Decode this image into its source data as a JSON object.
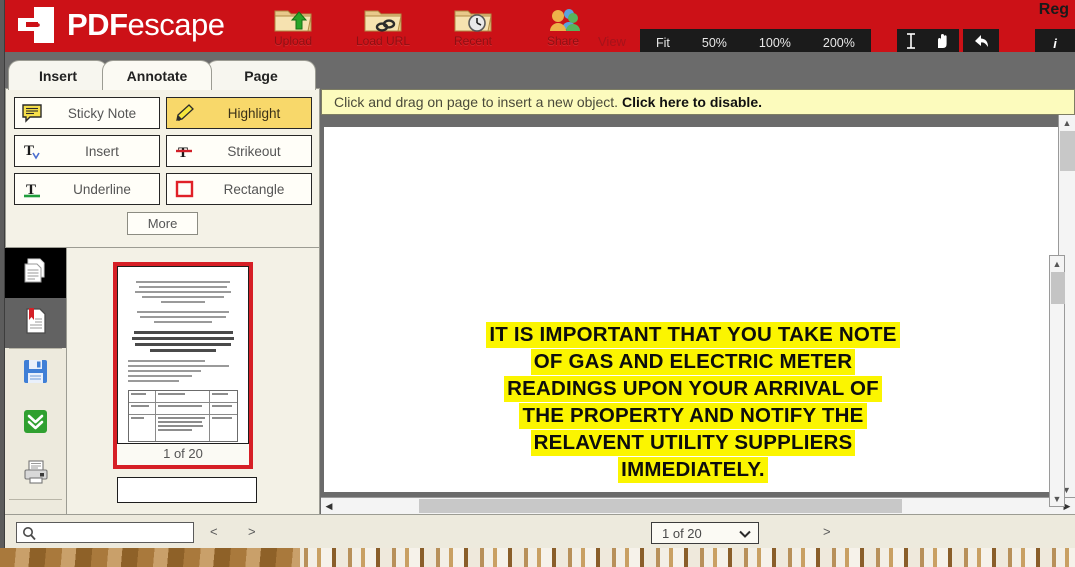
{
  "brand": {
    "name_bold": "PDF",
    "name_light": "escape",
    "logo_icon": "pdf-door-logo-icon",
    "red": "#CC1117"
  },
  "topbar": {
    "register_label": "Reg",
    "items": [
      {
        "label": "Upload",
        "icon": "folder-upload-icon"
      },
      {
        "label": "Load URL",
        "icon": "folder-link-icon"
      },
      {
        "label": "Recent",
        "icon": "folder-clock-icon"
      },
      {
        "label": "Share",
        "icon": "share-people-icon"
      }
    ],
    "view_label": "View",
    "zoom_options": [
      "Fit",
      "50%",
      "100%",
      "200%"
    ],
    "cursor_tools": [
      {
        "name": "text-select-tool",
        "icon": "i-beam-icon"
      },
      {
        "name": "hand-pan-tool",
        "icon": "hand-icon"
      }
    ],
    "undo_icon": "undo-arrow-icon",
    "info_label": "i"
  },
  "tabs": [
    {
      "label": "Insert",
      "active": false
    },
    {
      "label": "Annotate",
      "active": true
    },
    {
      "label": "Page",
      "active": false
    }
  ],
  "tools": {
    "buttons": [
      {
        "label": "Sticky Note",
        "icon": "sticky-note-icon",
        "active": false
      },
      {
        "label": "Highlight",
        "icon": "highlighter-icon",
        "active": true
      },
      {
        "label": "Insert",
        "icon": "insert-text-icon",
        "active": false
      },
      {
        "label": "Strikeout",
        "icon": "strikeout-icon",
        "active": false
      },
      {
        "label": "Underline",
        "icon": "underline-icon",
        "active": false
      },
      {
        "label": "Rectangle",
        "icon": "rectangle-icon",
        "active": false
      }
    ],
    "more_label": "More",
    "active_color": "#F8D86A"
  },
  "rail": [
    {
      "name": "pages-panel",
      "icon": "pages-icon",
      "state": "active"
    },
    {
      "name": "bookmarks-panel",
      "icon": "bookmark-page-icon",
      "state": "hover"
    },
    {
      "name": "save-document",
      "icon": "floppy-save-icon",
      "state": "normal"
    },
    {
      "name": "download-document",
      "icon": "download-arrow-icon",
      "state": "normal"
    },
    {
      "name": "print-document",
      "icon": "printer-icon",
      "state": "normal"
    },
    {
      "name": "new-object",
      "icon": "blue-square-icon",
      "state": "normal"
    }
  ],
  "notice": {
    "text": "Click and drag on page to insert a new object. ",
    "link": "Click here to disable."
  },
  "thumbnail": {
    "label": "1 of 20",
    "selected": true
  },
  "document": {
    "lines": [
      "IT IS IMPORTANT THAT YOU TAKE NOTE",
      "OF GAS AND ELECTRIC METER",
      "READINGS UPON YOUR ARRIVAL OF",
      "THE PROPERTY AND NOTIFY THE",
      "RELAVENT UTILITY SUPPLIERS",
      "IMMEDIATELY."
    ],
    "highlight_color": "#FBF500"
  },
  "bottombar": {
    "search_placeholder": "",
    "search_value": "",
    "search_icon": "magnifier-icon",
    "prev_label": "<",
    "next_label": ">",
    "page_value": "1 of 20",
    "page_next_label": ">"
  }
}
